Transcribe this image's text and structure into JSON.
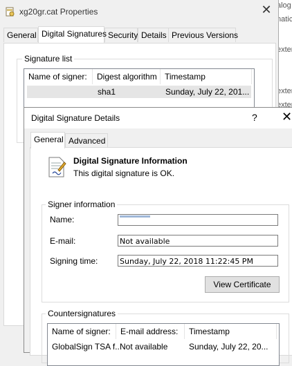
{
  "background_window": {
    "lines": [
      "alog",
      "natic",
      "exter",
      "exter",
      "exter"
    ]
  },
  "properties": {
    "title": "xg20gr.cat Properties",
    "tabs": [
      "General",
      "Digital Signatures",
      "Security",
      "Details",
      "Previous Versions"
    ],
    "signature_list_label": "Signature list",
    "columns": [
      "Name of signer:",
      "Digest algorithm",
      "Timestamp"
    ],
    "rows": [
      {
        "signer": "",
        "digest": "sha1",
        "timestamp": "Sunday, July 22, 201..."
      }
    ]
  },
  "details": {
    "title": "Digital Signature Details",
    "help": "?",
    "tabs": [
      "General",
      "Advanced"
    ],
    "info_heading": "Digital Signature Information",
    "info_status": "This digital signature is OK.",
    "signer_info_label": "Signer information",
    "name_label": "Name:",
    "name_value": "",
    "email_label": "E-mail:",
    "email_value": "Not available",
    "signing_time_label": "Signing time:",
    "signing_time_value": "Sunday, July 22, 2018 11:22:45 PM",
    "view_certificate": "View Certificate",
    "countersignatures_label": "Countersignatures",
    "counter_columns": [
      "Name of signer:",
      "E-mail address:",
      "Timestamp"
    ],
    "counter_rows": [
      {
        "signer": "GlobalSign TSA f...",
        "email": "Not available",
        "timestamp": "Sunday, July 22, 20..."
      }
    ]
  }
}
